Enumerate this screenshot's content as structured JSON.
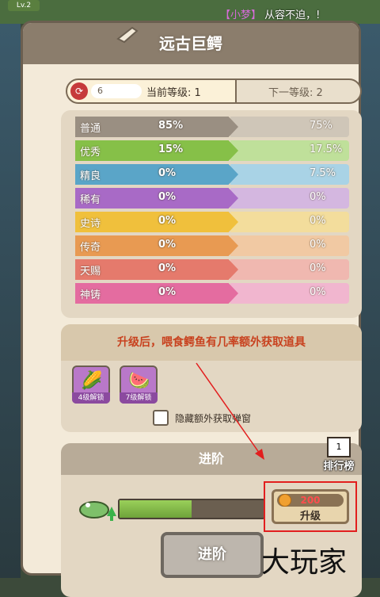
{
  "top": {
    "level_badge": "Lv.2",
    "chat_user": "【小梦】",
    "chat_text": "从容不迫，!"
  },
  "panel": {
    "title": "远古巨鳄"
  },
  "level": {
    "icon_value": "6",
    "current_label": "当前等级: 1",
    "next_label": "下一等级: 2"
  },
  "rarity": [
    {
      "name": "普通",
      "current": "85%",
      "next": "75%",
      "color": "#9a8f82",
      "color_light": "#cfc6b8"
    },
    {
      "name": "优秀",
      "current": "15%",
      "next": "17.5%",
      "color": "#86c048",
      "color_light": "#bfe09a"
    },
    {
      "name": "精良",
      "current": "0%",
      "next": "7.5%",
      "color": "#5aa5c8",
      "color_light": "#a9d3e6"
    },
    {
      "name": "稀有",
      "current": "0%",
      "next": "0%",
      "color": "#a86ac6",
      "color_light": "#d4b7e0"
    },
    {
      "name": "史诗",
      "current": "0%",
      "next": "0%",
      "color": "#f0c03c",
      "color_light": "#f3dd9c"
    },
    {
      "name": "传奇",
      "current": "0%",
      "next": "0%",
      "color": "#e89a52",
      "color_light": "#f1c9a3"
    },
    {
      "name": "天赐",
      "current": "0%",
      "next": "0%",
      "color": "#e57a6c",
      "color_light": "#f0b8b0"
    },
    {
      "name": "神铸",
      "current": "0%",
      "next": "0%",
      "color": "#e46ca0",
      "color_light": "#f1b6cf"
    }
  ],
  "bonus": {
    "header": "升级后，喂食鳄鱼有几率额外获取道具",
    "items": [
      {
        "icon": "corn-icon",
        "badge": "4级解锁"
      },
      {
        "icon": "watermelon-icon",
        "badge": "7级解锁"
      }
    ],
    "checkbox_label": "隐藏额外获取弹窗"
  },
  "advance": {
    "header": "进阶",
    "rank_badge": "1",
    "rank_label": "排行榜",
    "progress": 0.5,
    "upgrade_cost": "200",
    "upgrade_label": "升级",
    "advance_button": "进阶"
  },
  "watermark": "大玩家"
}
